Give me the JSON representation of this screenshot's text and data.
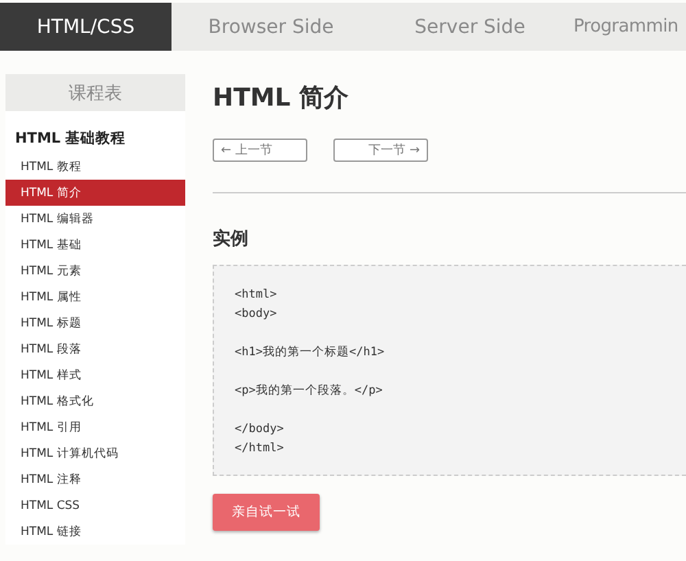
{
  "nav": {
    "tabs": [
      {
        "label": "HTML/CSS",
        "selected": true
      },
      {
        "label": "Browser Side",
        "selected": false
      },
      {
        "label": "Server Side",
        "selected": false
      },
      {
        "label": "Programmin",
        "selected": false
      }
    ]
  },
  "sidebar": {
    "header": "课程表",
    "section": "HTML 基础教程",
    "items": [
      {
        "label": "HTML 教程",
        "selected": false
      },
      {
        "label": "HTML 简介",
        "selected": true
      },
      {
        "label": "HTML 编辑器",
        "selected": false
      },
      {
        "label": "HTML 基础",
        "selected": false
      },
      {
        "label": "HTML 元素",
        "selected": false
      },
      {
        "label": "HTML 属性",
        "selected": false
      },
      {
        "label": "HTML 标题",
        "selected": false
      },
      {
        "label": "HTML 段落",
        "selected": false
      },
      {
        "label": "HTML 样式",
        "selected": false
      },
      {
        "label": "HTML 格式化",
        "selected": false
      },
      {
        "label": "HTML 引用",
        "selected": false
      },
      {
        "label": "HTML 计算机代码",
        "selected": false
      },
      {
        "label": "HTML 注释",
        "selected": false
      },
      {
        "label": "HTML CSS",
        "selected": false
      },
      {
        "label": "HTML 链接",
        "selected": false
      }
    ]
  },
  "main": {
    "title": "HTML 简介",
    "prev_button": "← 上一节",
    "next_button": "下一节 →",
    "example_heading": "实例",
    "code": "<html>\n<body>\n\n<h1>我的第一个标题</h1>\n\n<p>我的第一个段落。</p>\n\n</body>\n</html>",
    "try_button": "亲自试一试"
  }
}
